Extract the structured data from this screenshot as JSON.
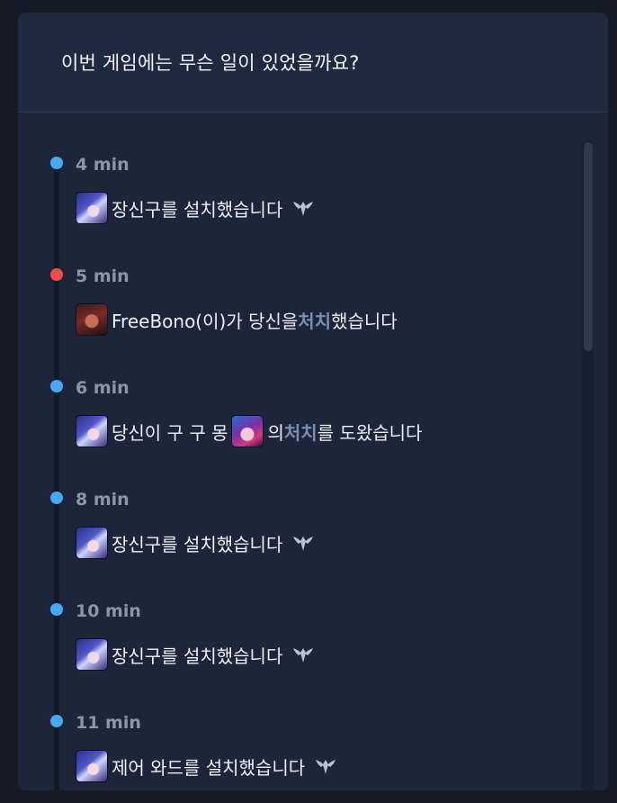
{
  "panel": {
    "title": "이번 게임에는 무슨 일이 있었을까요?"
  },
  "colors": {
    "ally_dot": "#47a8f5",
    "death_dot": "#f04b4b",
    "kill_highlight": "#7b8fb1"
  },
  "events": [
    {
      "time": "4 min",
      "dot": "ally",
      "avatar": "ahri",
      "text": "장신구를 설치했습니다",
      "icon": "ward-icon"
    },
    {
      "time": "5 min",
      "dot": "death",
      "avatar": "enemy",
      "prefix": "FreeBono(이)가 당신을 ",
      "highlight": "처치",
      "suffix": "했습니다"
    },
    {
      "time": "6 min",
      "dot": "ally",
      "avatar": "ahri",
      "prefix": "당신이 구 구 몽 ",
      "avatar2": "jinx",
      "middle": "의 ",
      "highlight": "처치",
      "suffix": "를 도왔습니다"
    },
    {
      "time": "8 min",
      "dot": "ally",
      "avatar": "ahri",
      "text": "장신구를 설치했습니다",
      "icon": "ward-icon"
    },
    {
      "time": "10 min",
      "dot": "ally",
      "avatar": "ahri",
      "text": "장신구를 설치했습니다",
      "icon": "ward-icon"
    },
    {
      "time": "11 min",
      "dot": "ally",
      "avatar": "ahri",
      "text": "제어 와드를 설치했습니다",
      "icon": "ward-icon"
    }
  ]
}
